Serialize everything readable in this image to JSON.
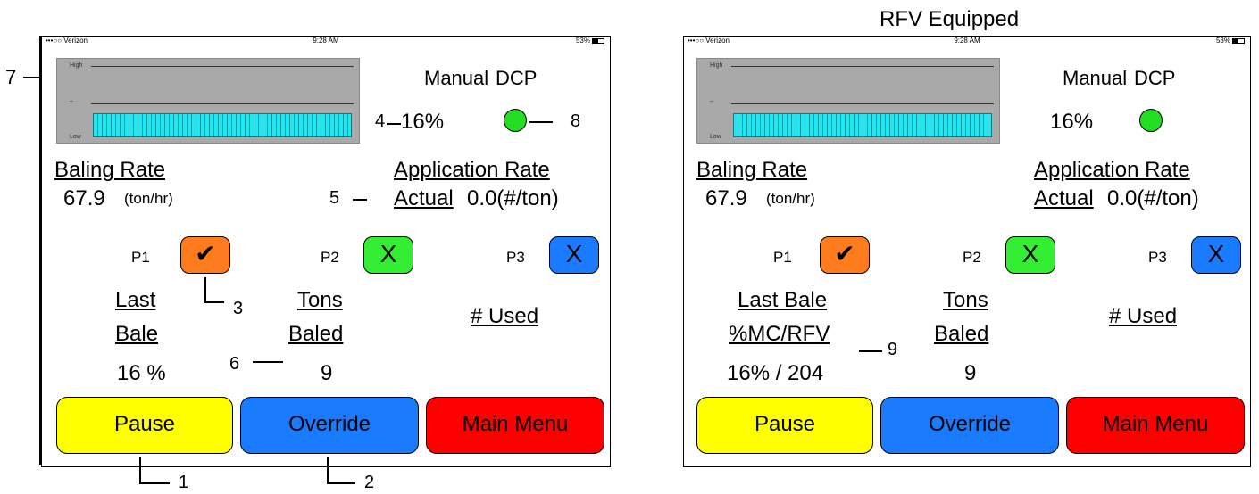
{
  "caption": "RFV Equipped",
  "status_bar": {
    "carrier": "•••○○ Verizon",
    "wifi_icon": "wifi-icon",
    "time": "9:28 AM",
    "battery": "53%"
  },
  "gauge": {
    "high_label": "High",
    "mid_label": "–",
    "low_label": "Low",
    "level_fraction": 0.16
  },
  "mode": {
    "manual": "Manual",
    "dcp": "DCP",
    "percent": "16%",
    "status_color": "#22dd22"
  },
  "baling_rate": {
    "label": "Baling Rate",
    "value": "67.9",
    "unit": "(ton/hr)"
  },
  "application_rate": {
    "label": "Application Rate",
    "actual_label": "Actual",
    "value": "0.0(#/ton)"
  },
  "pumps": [
    {
      "label": "P1",
      "mark": "✔",
      "color": "#ff7c1e"
    },
    {
      "label": "P2",
      "mark": "X",
      "color": "#33ee33"
    },
    {
      "label": "P3",
      "mark": "X",
      "color": "#1a7bff"
    }
  ],
  "left_panel": {
    "last_bale_line1": "Last",
    "last_bale_line2": "Bale",
    "last_bale_value": "16 %"
  },
  "right_panel": {
    "last_bale_line1": "Last Bale",
    "last_bale_line2": "%MC/RFV",
    "last_bale_value": "16% / 204"
  },
  "tons_baled": {
    "line1": "Tons",
    "line2": "Baled",
    "value": "9"
  },
  "used": {
    "label": "# Used"
  },
  "buttons": {
    "pause": "Pause",
    "override": "Override",
    "main_menu": "Main Menu"
  },
  "callouts": {
    "c1": "1",
    "c2": "2",
    "c3": "3",
    "c4": "4",
    "c5": "5",
    "c6": "6",
    "c7": "7",
    "c8": "8",
    "c9": "9"
  }
}
